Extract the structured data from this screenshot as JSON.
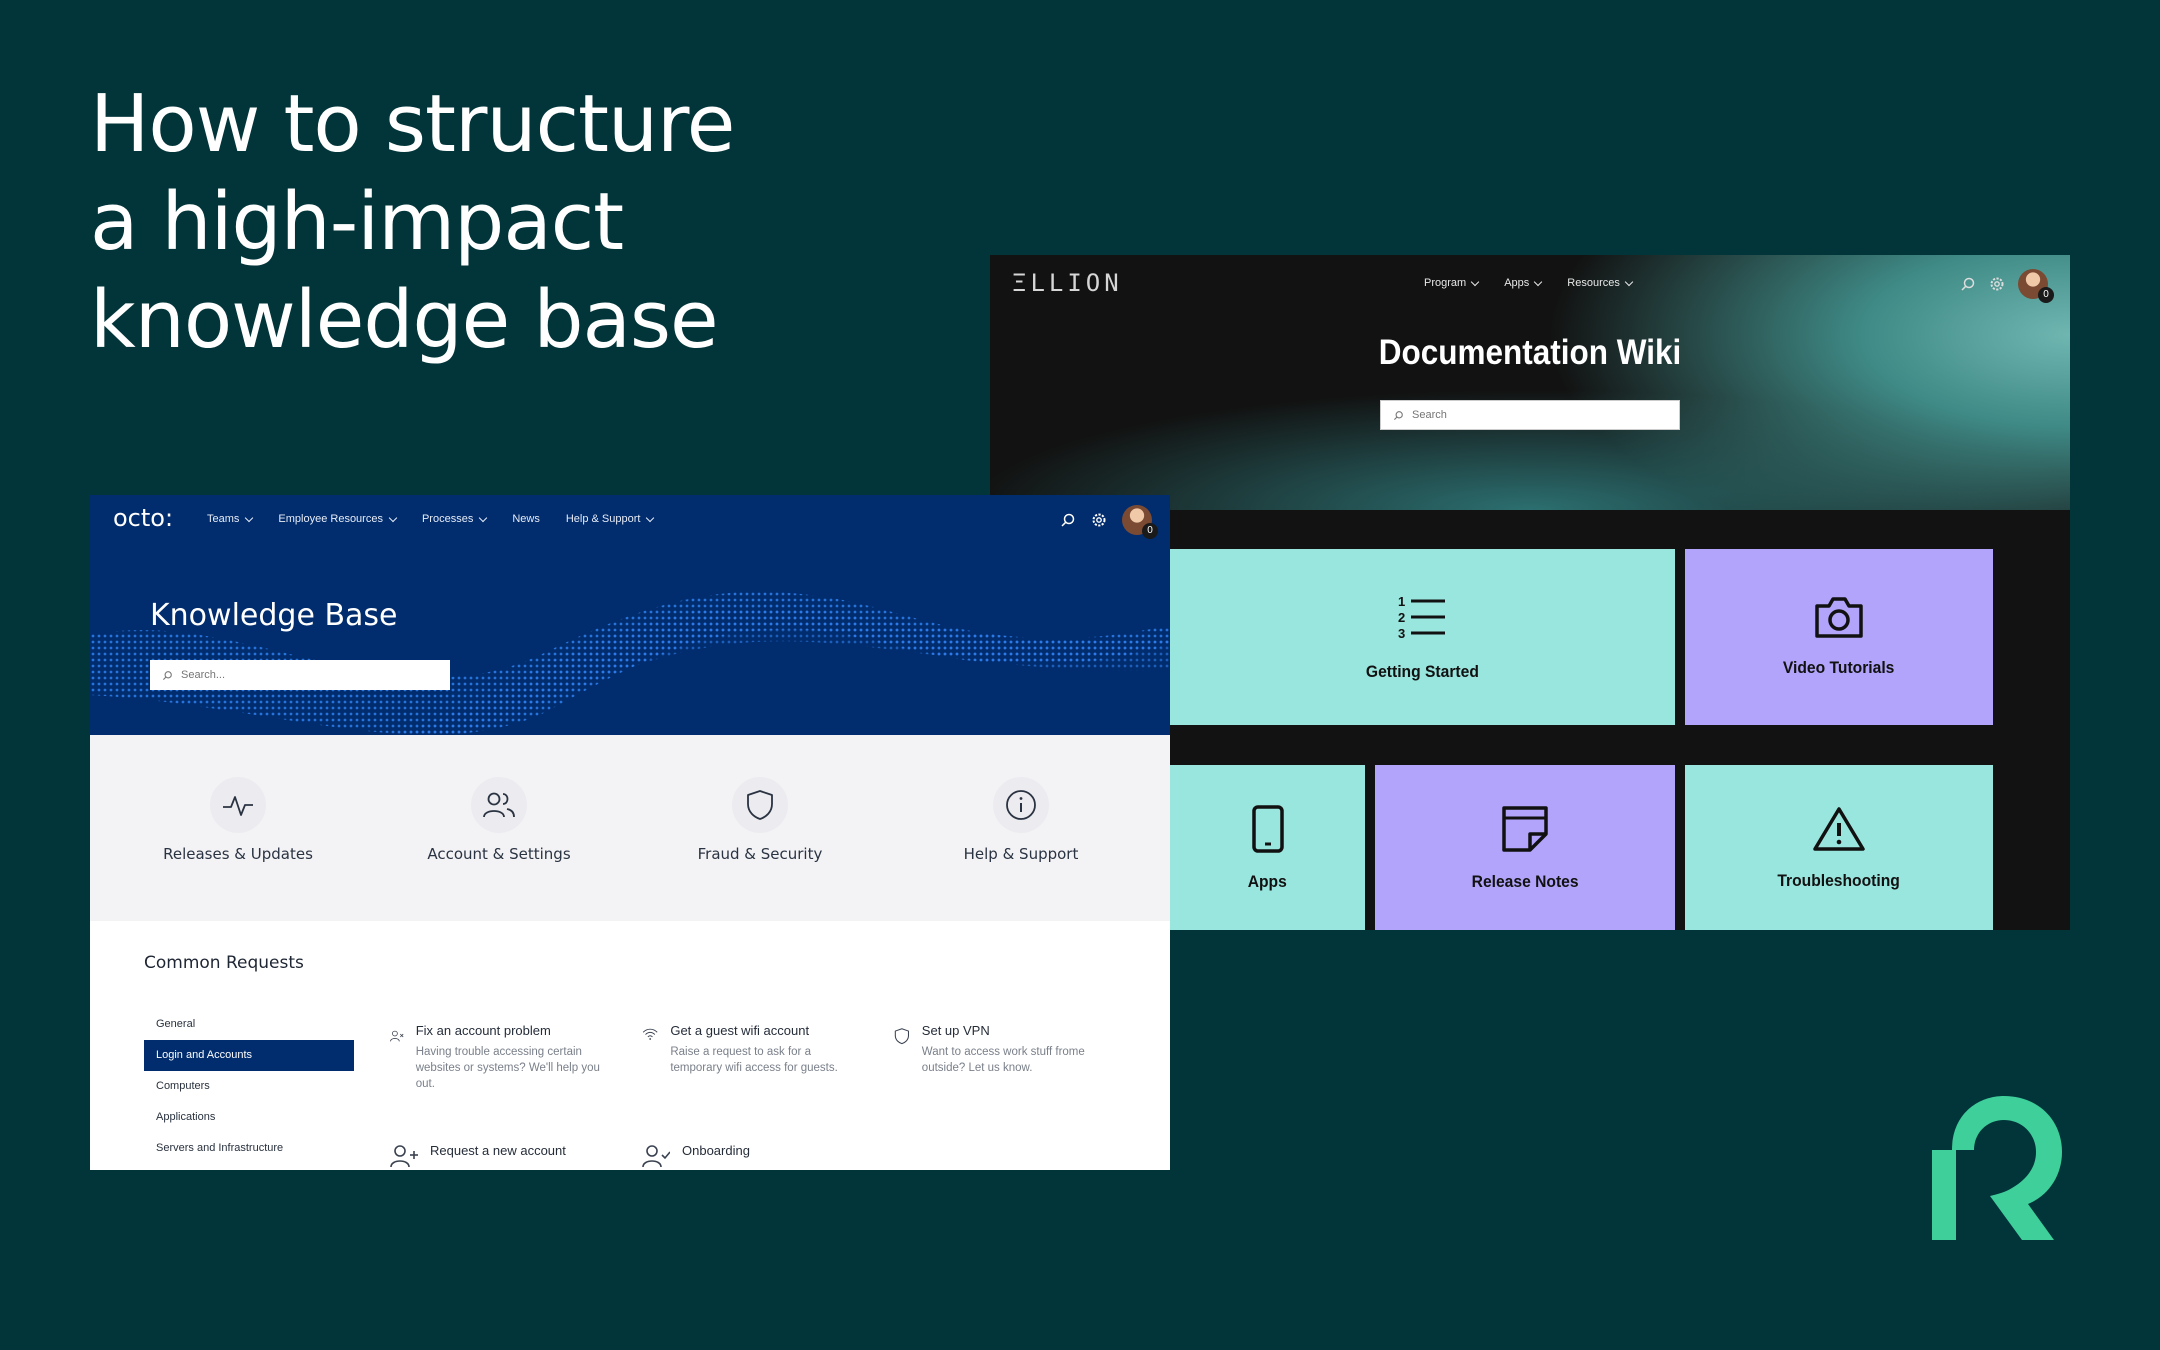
{
  "headline": {
    "line1": "How to structure",
    "line2": "a high-impact",
    "line3": "knowledge base"
  },
  "ellion": {
    "logo": "ΞLLION",
    "nav": [
      {
        "label": "Program"
      },
      {
        "label": "Apps"
      },
      {
        "label": "Resources"
      }
    ],
    "notification_count": "0",
    "title": "Documentation Wiki",
    "search_placeholder": "Search",
    "tiles": [
      {
        "label": "Getting Started",
        "icon": "numbered-list-icon",
        "color": "#99e6de"
      },
      {
        "label": "Video Tutorials",
        "icon": "camera-icon",
        "color": "#b3a4fb"
      },
      {
        "label": "Apps",
        "icon": "phone-icon",
        "color": "#99e6de"
      },
      {
        "label": "Release Notes",
        "icon": "note-icon",
        "color": "#b3a4fb"
      },
      {
        "label": "Troubleshooting",
        "icon": "warning-icon",
        "color": "#99e6de"
      }
    ]
  },
  "octo": {
    "logo": "octo:",
    "nav": [
      {
        "label": "Teams"
      },
      {
        "label": "Employee Resources"
      },
      {
        "label": "Processes"
      },
      {
        "label": "News"
      },
      {
        "label": "Help & Support"
      }
    ],
    "notification_count": "0",
    "title": "Knowledge Base",
    "search_placeholder": "Search...",
    "categories": [
      {
        "label": "Releases & Updates",
        "icon": "activity-icon"
      },
      {
        "label": "Account & Settings",
        "icon": "users-icon"
      },
      {
        "label": "Fraud & Security",
        "icon": "shield-icon"
      },
      {
        "label": "Help & Support",
        "icon": "info-icon"
      }
    ],
    "common_requests": {
      "title": "Common Requests",
      "sidebar": [
        "General",
        "Login and Accounts",
        "Computers",
        "Applications",
        "Servers and Infrastructure"
      ],
      "active": "Login and Accounts",
      "items": [
        {
          "title": "Fix an account problem",
          "desc": "Having trouble accessing certain websites or systems? We'll help you out.",
          "icon": "user-x-icon"
        },
        {
          "title": "Get a guest wifi account",
          "desc": "Raise a request to ask for a temporary wifi access for guests.",
          "icon": "wifi-icon"
        },
        {
          "title": "Set up VPN",
          "desc": "Want to access work stuff frome outside? Let us know.",
          "icon": "shield-icon"
        },
        {
          "title": "Request a new account",
          "desc": "",
          "icon": "user-plus-icon"
        },
        {
          "title": "Onboarding",
          "desc": "",
          "icon": "user-check-icon"
        }
      ]
    }
  },
  "brand": {
    "logo_color": "#3ecf9a"
  }
}
